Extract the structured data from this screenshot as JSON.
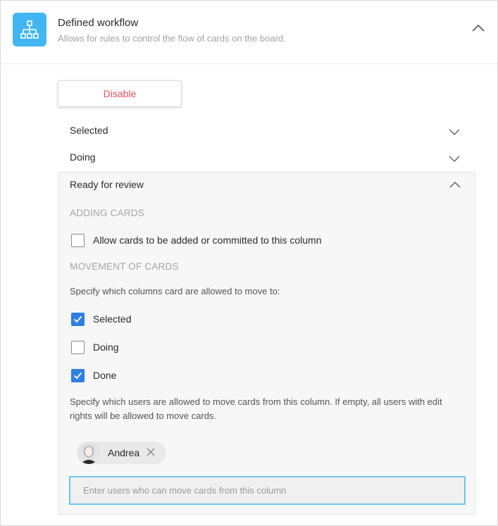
{
  "header": {
    "title": "Defined workflow",
    "subtitle": "Allows for rules to control the flow of cards on the board.",
    "icon": "workflow-hierarchy-icon",
    "accent_color": "#41b6f2"
  },
  "disable_button": {
    "label": "Disable",
    "color": "#e8505b"
  },
  "columns": [
    {
      "label": "Selected",
      "expanded": false
    },
    {
      "label": "Doing",
      "expanded": false
    },
    {
      "label": "Ready for review",
      "expanded": true
    }
  ],
  "expanded_panel": {
    "adding_cards": {
      "title": "ADDING CARDS",
      "allow_label": "Allow cards to be added or committed to this column",
      "allow_checked": false
    },
    "movement": {
      "title": "MOVEMENT OF CARDS",
      "help_columns": "Specify which columns card are allowed to move to:",
      "options": [
        {
          "label": "Selected",
          "checked": true
        },
        {
          "label": "Doing",
          "checked": false
        },
        {
          "label": "Done",
          "checked": true
        }
      ],
      "help_users": "Specify which users are allowed to move cards from this column. If empty, all users with edit rights will be allowed to move cards.",
      "users": [
        {
          "name": "Andrea"
        }
      ],
      "input_placeholder": "Enter users who can move cards from this column"
    }
  },
  "colors": {
    "checkbox_checked": "#2d7fe0",
    "input_focus_border": "#6bc6ea"
  }
}
